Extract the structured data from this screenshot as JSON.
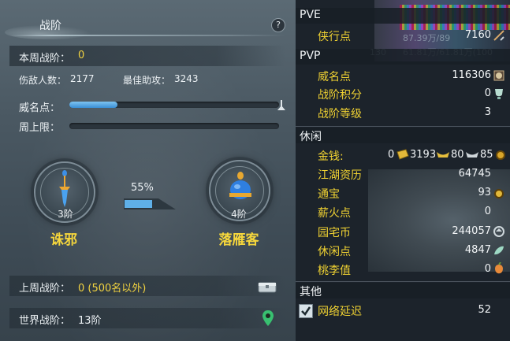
{
  "left": {
    "title": "战阶",
    "help_label": "?",
    "weekly_rank_label": "本周战阶：",
    "weekly_rank_value": "0",
    "kills_label": "伤敌人数：",
    "kills_value": "2177",
    "best_assist_label": "最佳助攻：",
    "best_assist_value": "3243",
    "prestige_label": "威名点：",
    "prestige_progress": 0.23,
    "weekly_cap_label": "周上限：",
    "weekly_cap_progress": 0.0,
    "medal_left": {
      "rank": "3阶",
      "name": "诛邪"
    },
    "medal_right": {
      "rank": "4阶",
      "name": "落雁客"
    },
    "progress_pct_text": "55%",
    "progress_pct_value": 0.55,
    "last_week_label": "上周战阶：",
    "last_week_value": "0 (500名以外)",
    "world_rank_label": "世界战阶：",
    "world_rank_value": "13阶"
  },
  "right": {
    "top_overlay": {
      "bg_number_1": "87.39万/89",
      "bg_number_2": "130",
      "bg_number_3": "61.81万/61.81万(100"
    },
    "pve": {
      "title": "PVE",
      "rows": [
        {
          "name": "侠行点",
          "value": "7160"
        }
      ]
    },
    "pvp": {
      "title": "PVP",
      "rows": [
        {
          "name": "威名点",
          "value": "116306"
        },
        {
          "name": "战阶积分",
          "value": "0"
        },
        {
          "name": "战阶等级",
          "value": "3"
        }
      ]
    },
    "leisure": {
      "title": "休闲",
      "money_name": "金钱:",
      "money_gold": "0",
      "money_silver": "3193",
      "money_copper": "80",
      "money_extra": "85",
      "rows": [
        {
          "name": "江湖资历",
          "value": "64745"
        },
        {
          "name": "通宝",
          "value": "93"
        },
        {
          "name": "薪火点",
          "value": "0"
        },
        {
          "name": "园宅币",
          "value": "244057"
        },
        {
          "name": "休闲点",
          "value": "4847"
        },
        {
          "name": "桃李值",
          "value": "0"
        }
      ]
    },
    "other": {
      "title": "其他",
      "rows": [
        {
          "name": "网络延迟",
          "value": "52"
        }
      ]
    }
  },
  "colors": {
    "accent_yellow": "#f2d340",
    "bar_blue": "#3a8ed4"
  }
}
